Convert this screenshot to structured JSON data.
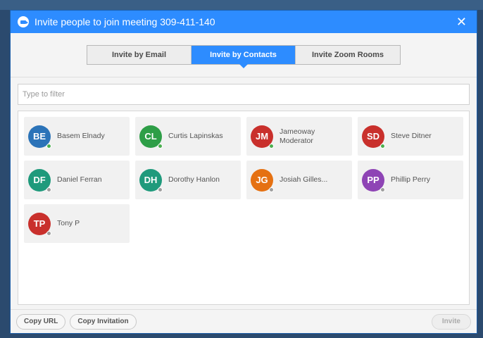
{
  "window": {
    "title": "Invite people to join meeting 309-411-140",
    "close_glyph": "✕"
  },
  "tabs": [
    {
      "label": "Invite by Email",
      "active": false
    },
    {
      "label": "Invite by Contacts",
      "active": true
    },
    {
      "label": "Invite Zoom Rooms",
      "active": false
    }
  ],
  "filter": {
    "placeholder": "Type to filter",
    "value": ""
  },
  "contacts": [
    {
      "initials": "BE",
      "name": "Basem Elnady",
      "avatar_color": "#2b73b8",
      "status_color": "#4caf50"
    },
    {
      "initials": "CL",
      "name": "Curtis Lapinskas",
      "avatar_color": "#2e9e47",
      "status_color": "#4caf50"
    },
    {
      "initials": "JM",
      "name": "Jameoway Moderator",
      "avatar_color": "#c9302c",
      "status_color": "#4caf50"
    },
    {
      "initials": "SD",
      "name": "Steve Ditner",
      "avatar_color": "#c9302c",
      "status_color": "#4caf50"
    },
    {
      "initials": "DF",
      "name": "Daniel Ferran",
      "avatar_color": "#1f9a7c",
      "status_color": "#9e9e9e"
    },
    {
      "initials": "DH",
      "name": "Dorothy Hanlon",
      "avatar_color": "#1f9a7c",
      "status_color": "#9e9e9e"
    },
    {
      "initials": "JG",
      "name": "Josiah Gilles...",
      "avatar_color": "#e57112",
      "status_color": "#9e9e9e"
    },
    {
      "initials": "PP",
      "name": "Phillip Perry",
      "avatar_color": "#8e44b5",
      "status_color": "#9e9e9e"
    },
    {
      "initials": "TP",
      "name": "Tony P",
      "avatar_color": "#c9302c",
      "status_color": "#9e9e9e"
    }
  ],
  "footer": {
    "copy_url_label": "Copy URL",
    "copy_invitation_label": "Copy Invitation",
    "invite_label": "Invite"
  },
  "colors": {
    "accent": "#2d8cff"
  }
}
